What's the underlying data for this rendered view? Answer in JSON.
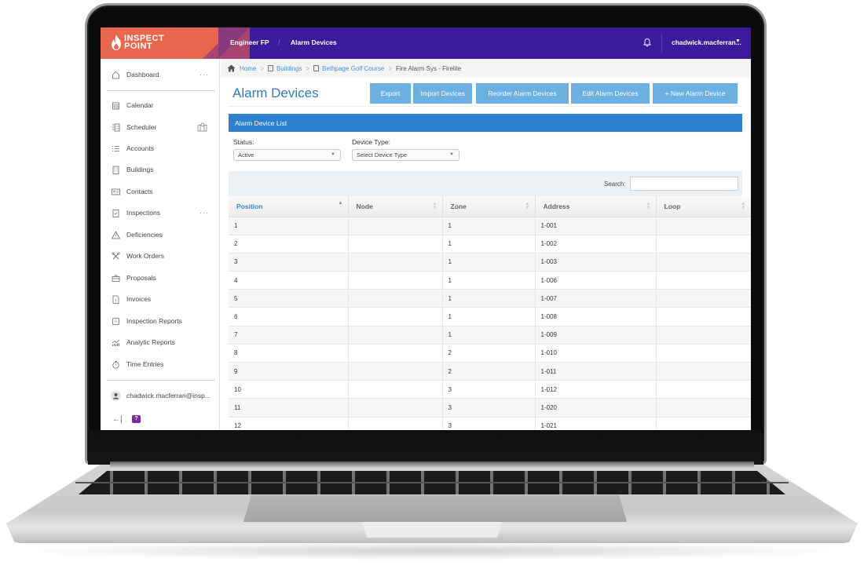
{
  "brand": {
    "line1": "INSPECT",
    "line2": "POINT",
    "colors": {
      "brand": "#e8674f",
      "topbar": "#3c1a9c",
      "accent": "#2f7fcf",
      "button": "#6bb0e0"
    }
  },
  "topbar": {
    "crumbs": [
      "Engineer FP",
      "Alarm Devices"
    ],
    "separator": "/",
    "bell_icon": "bell-icon",
    "user": "chadwick.macferran...",
    "caret": "▼"
  },
  "sidebar": {
    "items": [
      {
        "label": "Dashboard",
        "icon": "home-icon",
        "more": "···"
      },
      {
        "label": "Calendar",
        "icon": "calendar-icon"
      },
      {
        "label": "Scheduler",
        "icon": "scheduler-icon",
        "extra": "map-icon"
      },
      {
        "label": "Accounts",
        "icon": "list-icon"
      },
      {
        "label": "Buildings",
        "icon": "building-icon"
      },
      {
        "label": "Contacts",
        "icon": "contact-card-icon"
      },
      {
        "label": "Inspections",
        "icon": "clipboard-check-icon",
        "more": "···"
      },
      {
        "label": "Deficiencies",
        "icon": "warning-icon"
      },
      {
        "label": "Work Orders",
        "icon": "tools-icon"
      },
      {
        "label": "Proposals",
        "icon": "briefcase-icon"
      },
      {
        "label": "Invoices",
        "icon": "invoice-icon"
      },
      {
        "label": "Inspection Reports",
        "icon": "report-icon"
      },
      {
        "label": "Analytic Reports",
        "icon": "chart-icon"
      },
      {
        "label": "Time Entries",
        "icon": "stopwatch-icon"
      }
    ],
    "account": "chadwick.macferran@insp...",
    "collapse": "←|",
    "chat": "?"
  },
  "breadcrumb": {
    "items": [
      "Home",
      "Buildings",
      "Bethpage Golf Course"
    ],
    "current": "Fire Alarm Sys - Firelite",
    "separator": ">"
  },
  "page": {
    "title": "Alarm Devices",
    "buttons": {
      "export": "Export",
      "import": "Import Devices",
      "reorder": "Reorder Alarm Devices",
      "edit": "Edit Alarm Devices",
      "new": "+ New Alarm Device"
    },
    "panel_title": "Alarm Device List",
    "filters": {
      "status_label": "Status:",
      "status_value": "Active",
      "type_label": "Device Type:",
      "type_value": "Select Device Type"
    },
    "search": {
      "label": "Search:",
      "value": ""
    }
  },
  "table": {
    "columns": [
      "Position",
      "Node",
      "Zone",
      "Address",
      "Loop"
    ],
    "sorted_column": "Position",
    "sort_direction": "asc",
    "rows": [
      [
        "1",
        "",
        "1",
        "1-001",
        ""
      ],
      [
        "2",
        "",
        "1",
        "1-002",
        ""
      ],
      [
        "3",
        "",
        "1",
        "1-003",
        ""
      ],
      [
        "4",
        "",
        "1",
        "1-006",
        ""
      ],
      [
        "5",
        "",
        "1",
        "1-007",
        ""
      ],
      [
        "6",
        "",
        "1",
        "1-008",
        ""
      ],
      [
        "7",
        "",
        "1",
        "1-009",
        ""
      ],
      [
        "8",
        "",
        "2",
        "1-010",
        ""
      ],
      [
        "9",
        "",
        "2",
        "1-011",
        ""
      ],
      [
        "10",
        "",
        "3",
        "1-012",
        ""
      ],
      [
        "11",
        "",
        "3",
        "1-020",
        ""
      ],
      [
        "12",
        "",
        "3",
        "1-021",
        ""
      ]
    ]
  }
}
